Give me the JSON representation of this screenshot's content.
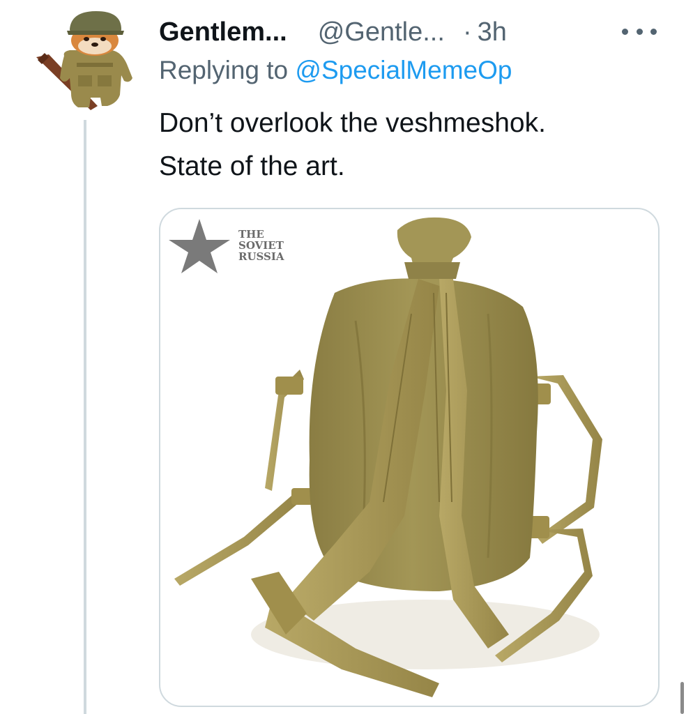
{
  "tweet": {
    "display_name": "Gentlem...",
    "handle": "@Gentle...",
    "separator": "·",
    "time": "3h",
    "reply_prefix": "Replying to",
    "reply_mention": "@SpecialMemeOp",
    "text_line_1": "Don’t overlook the veshmeshok.",
    "text_line_2": "State of the art."
  },
  "media": {
    "watermark": {
      "line_1": "THE",
      "line_2": "SOVIET",
      "line_3": "RUSSIA"
    }
  },
  "icons": {
    "more": "more-options-icon",
    "watermark_star": "star-icon"
  },
  "colors": {
    "name": "#0f1419",
    "secondary": "#536471",
    "link": "#1d9bf0",
    "border": "#cfd9de",
    "bag": "#9b8f52"
  }
}
